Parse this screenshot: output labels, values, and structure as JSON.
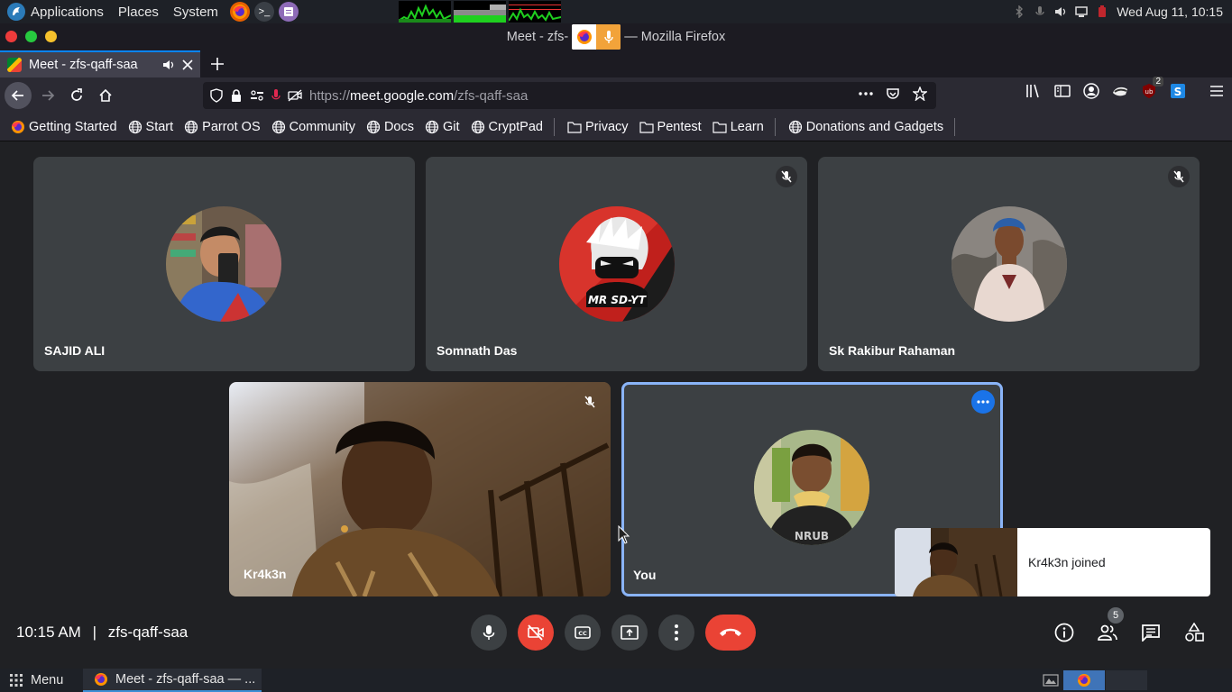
{
  "os_panel": {
    "menus": [
      "Applications",
      "Places",
      "System"
    ],
    "clock": "Wed Aug 11, 10:15",
    "launchers": [
      "firefox-icon",
      "terminal-icon",
      "text-editor-icon"
    ]
  },
  "window": {
    "title_prefix": "Meet - zfs-",
    "title_suffix": "— Mozilla Firefox"
  },
  "tab": {
    "label": "Meet - zfs-qaff-saa"
  },
  "urlbar": {
    "url_prefix": "https://",
    "url_host": "meet.google.com",
    "url_path": "/zfs-qaff-saa"
  },
  "extensions": {
    "ublock_badge": "2"
  },
  "bookmarks": [
    {
      "label": "Getting Started",
      "icon": "firefox-icon"
    },
    {
      "label": "Start",
      "icon": "globe-icon"
    },
    {
      "label": "Parrot OS",
      "icon": "globe-icon"
    },
    {
      "label": "Community",
      "icon": "globe-icon"
    },
    {
      "label": "Docs",
      "icon": "globe-icon"
    },
    {
      "label": "Git",
      "icon": "globe-icon"
    },
    {
      "label": "CryptPad",
      "icon": "globe-icon"
    },
    {
      "label": "Privacy",
      "icon": "folder-icon"
    },
    {
      "label": "Pentest",
      "icon": "folder-icon"
    },
    {
      "label": "Learn",
      "icon": "folder-icon"
    },
    {
      "label": "Donations and Gadgets",
      "icon": "globe-icon"
    }
  ],
  "participants": [
    {
      "name": "SAJID ALI",
      "muted": false,
      "video": false
    },
    {
      "name": "Somnath Das",
      "muted": true,
      "video": false,
      "avatar_text": "MR SD-YT"
    },
    {
      "name": "Sk Rakibur Rahaman",
      "muted": true,
      "video": false
    },
    {
      "name": "Kr4k3n",
      "muted": true,
      "video": true
    },
    {
      "name": "You",
      "muted": false,
      "video": false
    }
  ],
  "toast": {
    "message": "Kr4k3n joined"
  },
  "meeting": {
    "time": "10:15 AM",
    "separator": "|",
    "code": "zfs-qaff-saa",
    "people_count": "5"
  },
  "taskbar": {
    "menu_label": "Menu",
    "task_label": "Meet - zfs-qaff-saa — ..."
  },
  "colors": {
    "accent_blue": "#8ab4f8",
    "end_call_red": "#ea4335",
    "tile_bg": "#3c4043",
    "page_bg": "#202124"
  }
}
